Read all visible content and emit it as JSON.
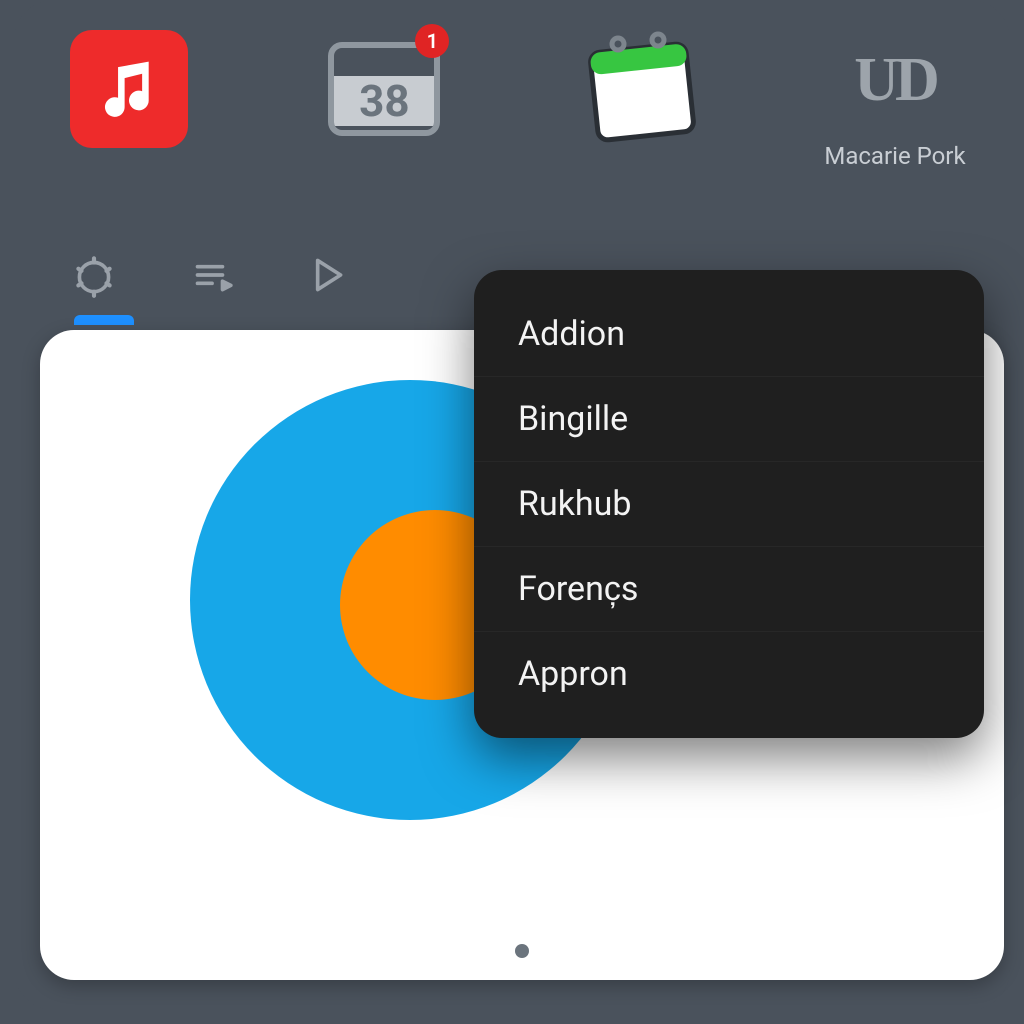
{
  "apps": {
    "music": {
      "name": "music-icon"
    },
    "calendar": {
      "day": "38",
      "badge": "1"
    },
    "notes": {
      "name": "notes-icon"
    },
    "ud": {
      "glyph": "UD",
      "label": "Macarie Pork"
    }
  },
  "toolbar": {
    "items": [
      {
        "name": "settings-icon"
      },
      {
        "name": "playlist-icon"
      },
      {
        "name": "play-icon"
      }
    ]
  },
  "menu": {
    "items": [
      {
        "label": "Addion"
      },
      {
        "label": "Bingille"
      },
      {
        "label": "Rukhub"
      },
      {
        "label": "Forenc̦s"
      },
      {
        "label": "Appron"
      }
    ]
  },
  "chart_data": {
    "type": "pie",
    "title": "",
    "series": [
      {
        "name": "Blue",
        "color": "#17a7e8",
        "value": 82
      },
      {
        "name": "Orange",
        "color": "#ff8c00",
        "value": 18
      }
    ]
  }
}
